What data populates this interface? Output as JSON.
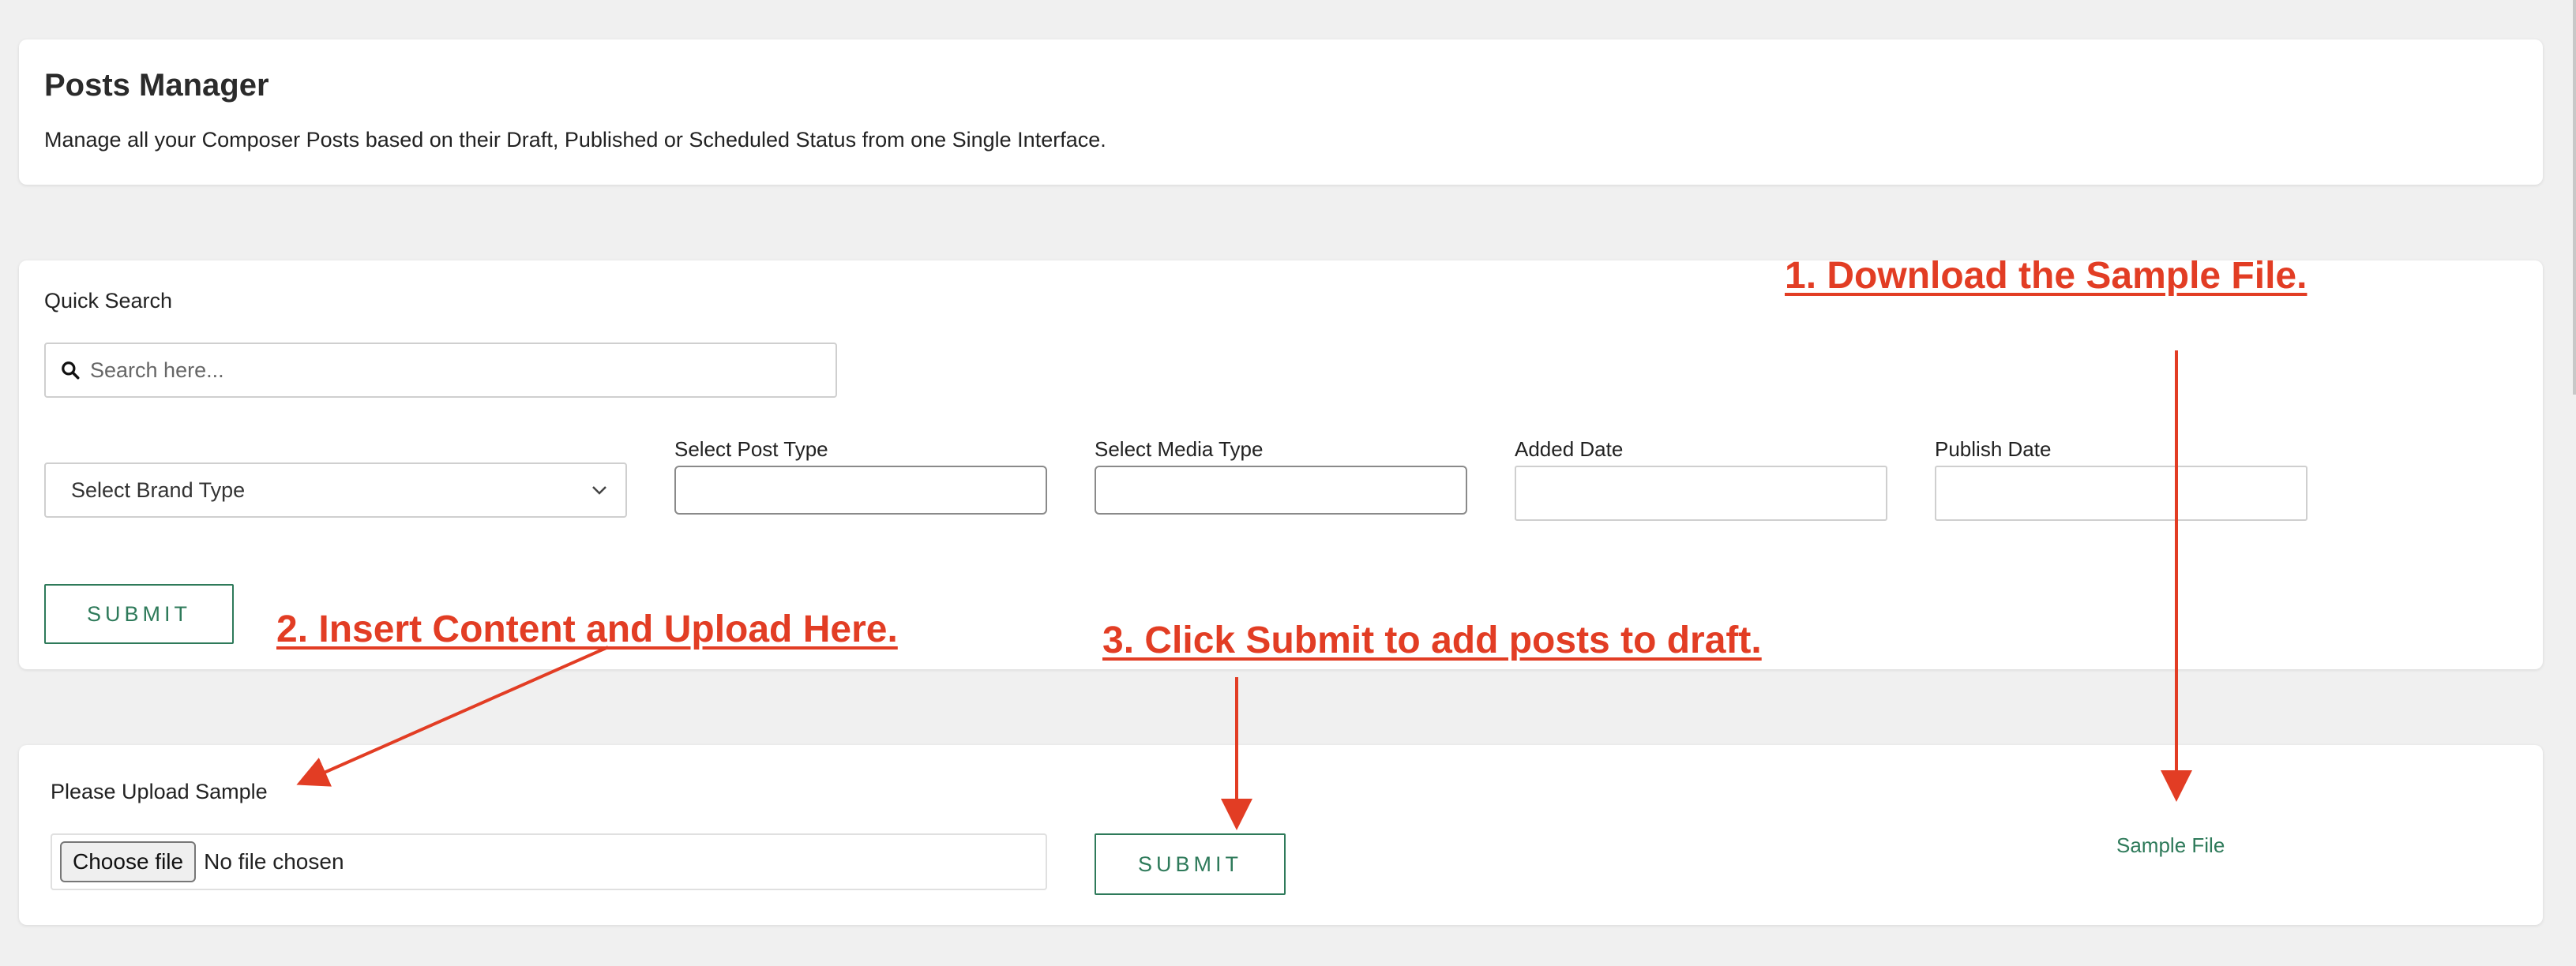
{
  "header": {
    "title": "Posts Manager",
    "description": "Manage all your Composer Posts based on their Draft, Published or Scheduled Status from one Single Interface."
  },
  "search": {
    "label": "Quick Search",
    "placeholder": "Search here...",
    "brand_select": "Select Brand Type",
    "post_type_label": "Select Post Type",
    "media_type_label": "Select Media Type",
    "added_date_label": "Added Date",
    "publish_date_label": "Publish Date",
    "submit_label": "SUBMIT"
  },
  "upload": {
    "label": "Please Upload Sample",
    "choose_file": "Choose file",
    "no_file": "No file chosen",
    "submit_label": "SUBMIT",
    "sample_file_link": "Sample File"
  },
  "annotations": {
    "step1": "1. Download the Sample File.",
    "step2": "2. Insert Content and Upload Here.",
    "step3": "3. Click Submit to add posts to draft.",
    "color": "#e23d24"
  },
  "colors": {
    "accent": "#2e7a5a",
    "background": "#f0f0f0"
  }
}
